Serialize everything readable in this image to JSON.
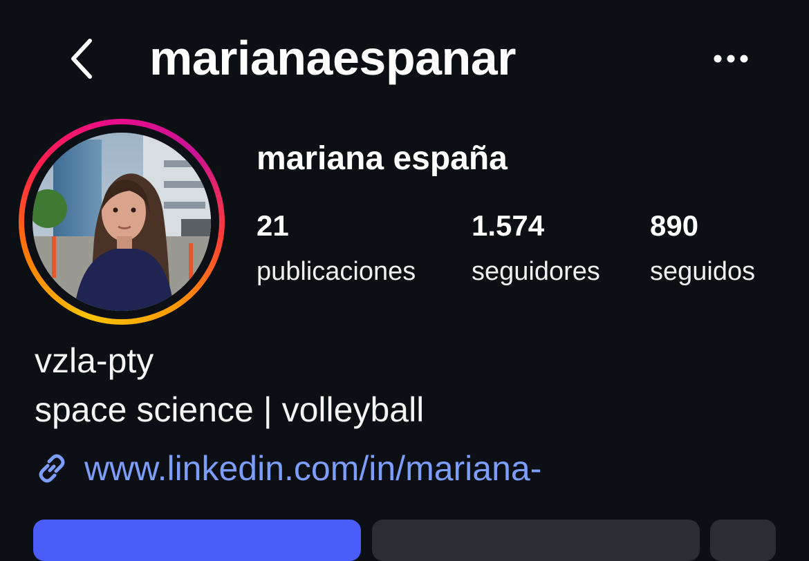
{
  "header": {
    "username": "marianaespanar"
  },
  "profile": {
    "display_name": "mariana españa",
    "stats": [
      {
        "count": "21",
        "label": "publicaciones"
      },
      {
        "count": "1.574",
        "label": "seguidores"
      },
      {
        "count": "890",
        "label": "seguidos"
      }
    ],
    "bio_lines": [
      "vzla-pty",
      "space science | volleyball"
    ],
    "link": "www.linkedin.com/in/mariana-"
  },
  "colors": {
    "background": "#0c0f14",
    "link": "#7d9dfb",
    "primary_button": "#4a5df9",
    "secondary_button": "#2a2d33"
  },
  "icons": {
    "back": "chevron-left-icon",
    "more": "more-horizontal-icon",
    "link": "link-icon"
  }
}
